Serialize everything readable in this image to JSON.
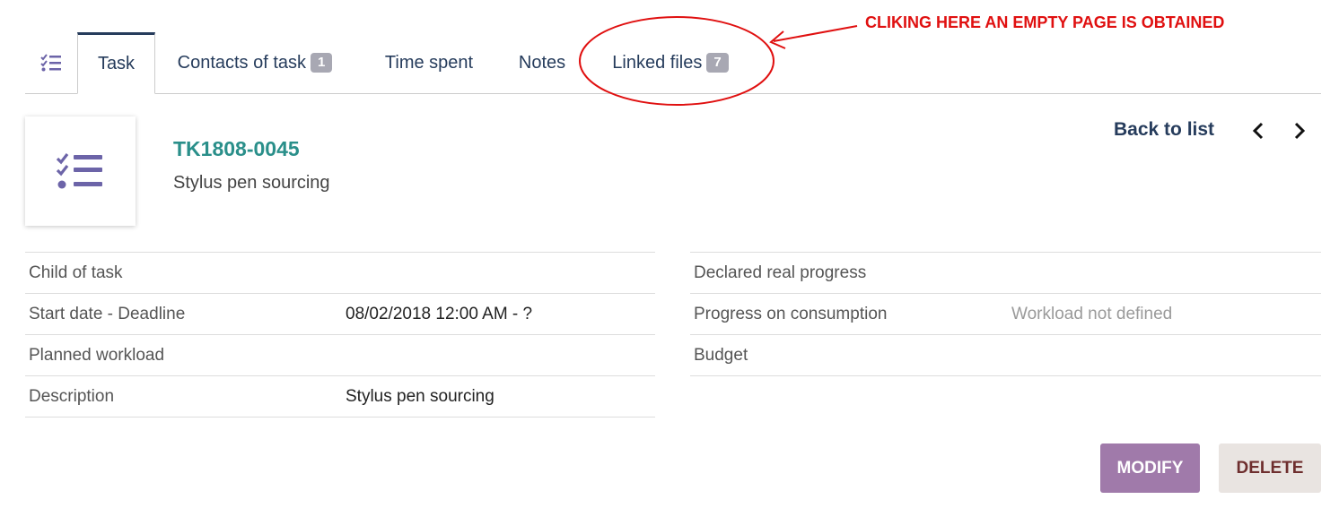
{
  "tabs": [
    {
      "label": "Task"
    },
    {
      "label": "Contacts of task",
      "badge": "1"
    },
    {
      "label": "Time spent"
    },
    {
      "label": "Notes"
    },
    {
      "label": "Linked files",
      "badge": "7"
    }
  ],
  "annotation": {
    "text": "CLIKING HERE AN EMPTY PAGE IS OBTAINED",
    "color": "#e01010"
  },
  "header": {
    "ref": "TK1808-0045",
    "label": "Stylus pen sourcing",
    "back_to_list": "Back to list"
  },
  "fields_left": [
    {
      "label": "Child of task",
      "value": ""
    },
    {
      "label": "Start date - Deadline",
      "value": "08/02/2018 12:00 AM - ?"
    },
    {
      "label": "Planned workload",
      "value": ""
    },
    {
      "label": "Description",
      "value": "Stylus pen sourcing"
    }
  ],
  "fields_right": [
    {
      "label": "Declared real progress",
      "value": ""
    },
    {
      "label": "Progress on consumption",
      "value": "Workload not defined"
    },
    {
      "label": "Budget",
      "value": ""
    }
  ],
  "buttons": {
    "modify": "MODIFY",
    "delete": "DELETE"
  },
  "colors": {
    "accent": "#263c5c",
    "ref": "#2a8f8a",
    "modify_bg": "#a07aaa",
    "delete_bg": "#e9e4e1",
    "icon": "#6c64a8"
  },
  "icons": {
    "tab": "task-list-icon",
    "header": "task-list-icon",
    "prev": "chevron-left-icon",
    "next": "chevron-right-icon"
  }
}
